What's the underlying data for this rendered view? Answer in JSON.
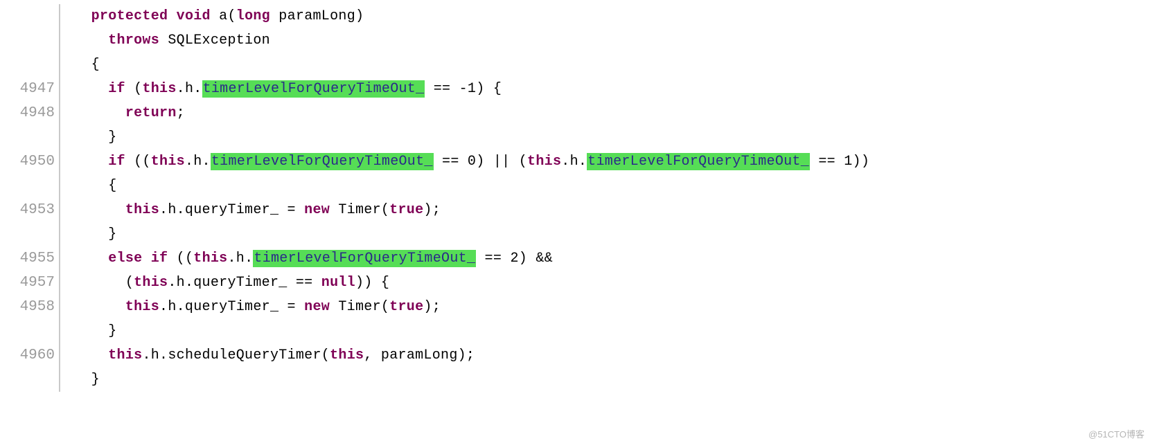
{
  "watermark": "@51CTO博客",
  "indent_unit": "  ",
  "colors": {
    "highlight_bg": "#56dd56",
    "keyword": "#7f0055",
    "gutter": "#9a9a9a",
    "hl_text": "#2a2a88"
  },
  "lines": [
    {
      "num": "",
      "indent": 1,
      "tokens": [
        {
          "t": "protected",
          "c": "kw"
        },
        {
          "t": " ",
          "c": "plain"
        },
        {
          "t": "void",
          "c": "kw"
        },
        {
          "t": " a(",
          "c": "plain"
        },
        {
          "t": "long",
          "c": "kw"
        },
        {
          "t": " paramLong)",
          "c": "plain"
        }
      ]
    },
    {
      "num": "",
      "indent": 2,
      "tokens": [
        {
          "t": "throws",
          "c": "kw"
        },
        {
          "t": " SQLException",
          "c": "plain"
        }
      ]
    },
    {
      "num": "",
      "indent": 1,
      "tokens": [
        {
          "t": "{",
          "c": "plain"
        }
      ]
    },
    {
      "num": "4947",
      "indent": 2,
      "tokens": [
        {
          "t": "if",
          "c": "kw"
        },
        {
          "t": " (",
          "c": "plain"
        },
        {
          "t": "this",
          "c": "kw"
        },
        {
          "t": ".h.",
          "c": "plain"
        },
        {
          "t": "timerLevelForQueryTimeOut_",
          "c": "hl"
        },
        {
          "t": " == -1) {",
          "c": "plain"
        }
      ]
    },
    {
      "num": "4948",
      "indent": 3,
      "tokens": [
        {
          "t": "return",
          "c": "kw"
        },
        {
          "t": ";",
          "c": "plain"
        }
      ]
    },
    {
      "num": "",
      "indent": 2,
      "tokens": [
        {
          "t": "}",
          "c": "plain"
        }
      ]
    },
    {
      "num": "4950",
      "indent": 2,
      "tokens": [
        {
          "t": "if",
          "c": "kw"
        },
        {
          "t": " ((",
          "c": "plain"
        },
        {
          "t": "this",
          "c": "kw"
        },
        {
          "t": ".h.",
          "c": "plain"
        },
        {
          "t": "timerLevelForQueryTimeOut_",
          "c": "hl"
        },
        {
          "t": " == 0) || (",
          "c": "plain"
        },
        {
          "t": "this",
          "c": "kw"
        },
        {
          "t": ".h.",
          "c": "plain"
        },
        {
          "t": "timerLevelForQueryTimeOut_",
          "c": "hl"
        },
        {
          "t": " == 1))",
          "c": "plain"
        }
      ]
    },
    {
      "num": "",
      "indent": 2,
      "tokens": [
        {
          "t": "{",
          "c": "plain"
        }
      ]
    },
    {
      "num": "4953",
      "indent": 3,
      "tokens": [
        {
          "t": "this",
          "c": "kw"
        },
        {
          "t": ".h.queryTimer_ = ",
          "c": "plain"
        },
        {
          "t": "new",
          "c": "kw"
        },
        {
          "t": " Timer(",
          "c": "plain"
        },
        {
          "t": "true",
          "c": "kw"
        },
        {
          "t": ");",
          "c": "plain"
        }
      ]
    },
    {
      "num": "",
      "indent": 2,
      "tokens": [
        {
          "t": "}",
          "c": "plain"
        }
      ]
    },
    {
      "num": "4955",
      "indent": 2,
      "tokens": [
        {
          "t": "else",
          "c": "kw"
        },
        {
          "t": " ",
          "c": "plain"
        },
        {
          "t": "if",
          "c": "kw"
        },
        {
          "t": " ((",
          "c": "plain"
        },
        {
          "t": "this",
          "c": "kw"
        },
        {
          "t": ".h.",
          "c": "plain"
        },
        {
          "t": "timerLevelForQueryTimeOut_",
          "c": "hl"
        },
        {
          "t": " == 2) &&",
          "c": "plain"
        }
      ]
    },
    {
      "num": "4957",
      "indent": 3,
      "tokens": [
        {
          "t": "(",
          "c": "plain"
        },
        {
          "t": "this",
          "c": "kw"
        },
        {
          "t": ".h.queryTimer_ == ",
          "c": "plain"
        },
        {
          "t": "null",
          "c": "kw"
        },
        {
          "t": ")) {",
          "c": "plain"
        }
      ]
    },
    {
      "num": "4958",
      "indent": 3,
      "tokens": [
        {
          "t": "this",
          "c": "kw"
        },
        {
          "t": ".h.queryTimer_ = ",
          "c": "plain"
        },
        {
          "t": "new",
          "c": "kw"
        },
        {
          "t": " Timer(",
          "c": "plain"
        },
        {
          "t": "true",
          "c": "kw"
        },
        {
          "t": ");",
          "c": "plain"
        }
      ]
    },
    {
      "num": "",
      "indent": 2,
      "tokens": [
        {
          "t": "}",
          "c": "plain"
        }
      ]
    },
    {
      "num": "4960",
      "indent": 2,
      "tokens": [
        {
          "t": "this",
          "c": "kw"
        },
        {
          "t": ".h.scheduleQueryTimer(",
          "c": "plain"
        },
        {
          "t": "this",
          "c": "kw"
        },
        {
          "t": ", paramLong);",
          "c": "plain"
        }
      ]
    },
    {
      "num": "",
      "indent": 1,
      "tokens": [
        {
          "t": "}",
          "c": "plain"
        }
      ]
    }
  ]
}
